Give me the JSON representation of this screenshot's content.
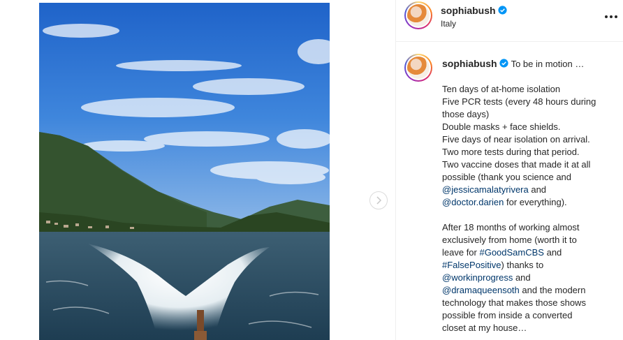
{
  "post": {
    "username": "sophiabush",
    "location": "Italy",
    "verified": true
  },
  "caption": {
    "username": "sophiabush",
    "first_line": "To be in motion …",
    "lines": [
      "Ten days of at-home isolation",
      "Five PCR tests (every 48 hours during",
      "those days)",
      "Double masks + face shields.",
      "Five days of near isolation on arrival.",
      "Two more tests during that period.",
      "Two vaccine doses that made it at all",
      "possible (thank you science and"
    ],
    "mention1": "@jessicamalatyrivera",
    "and1": " and",
    "mention2": "@doctor.darien",
    "after_mention2": " for everything).",
    "para2_lines": [
      "After 18 months of working almost",
      "exclusively from home (worth it to"
    ],
    "leave_for": "leave for ",
    "hashtag1": "#GoodSamCBS",
    "and2": " and",
    "hashtag2": "#FalsePositive",
    "thanks_to": ") thanks to",
    "mention3": "@workinprogress",
    "and3": " and",
    "mention4": "@dramaqueensoth",
    "after_mention4": " and the modern",
    "tail_lines": [
      "technology that makes those shows",
      "possible from inside a converted",
      "closet at my house…"
    ]
  },
  "icons": {
    "verified": "verified-badge-icon",
    "more": "more-options-icon",
    "next": "chevron-right-icon"
  },
  "colors": {
    "link": "#00376b",
    "verified": "#0095f6"
  }
}
